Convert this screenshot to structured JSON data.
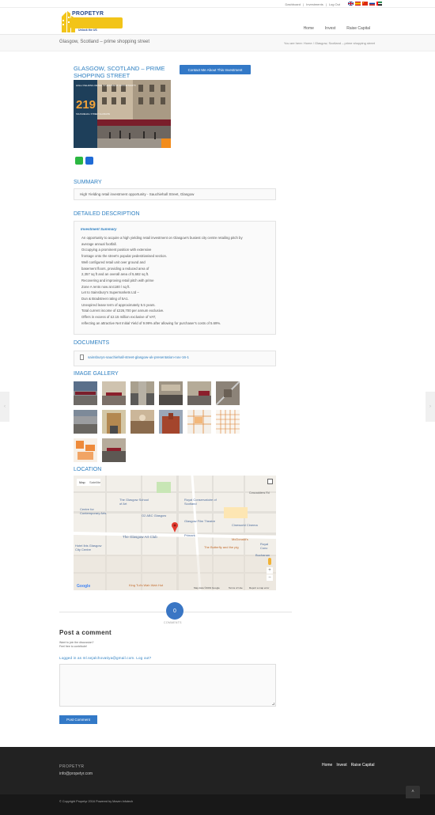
{
  "topbar": {
    "links": [
      "Dashboard",
      "Investments",
      "Log Out"
    ],
    "flags": [
      "uk-flag",
      "spain-flag",
      "china-flag",
      "russia-flag",
      "uae-flag"
    ]
  },
  "header": {
    "logo_text": "PROPETYR",
    "logo_tagline": "Unlock the US",
    "nav": [
      "Home",
      "Invest",
      "Raise Capital"
    ]
  },
  "breadcrumb_bar": {
    "page_title": "Glasgow, Scotland – prime shopping street",
    "you_are_here": "You are here:",
    "crumbs": [
      "Home",
      "Glasgow, Scotland – prime shopping street"
    ]
  },
  "property": {
    "title": "GLASGOW, SCOTLAND – PRIME SHOPPING STREET",
    "contact_button": "Contact Me About This Investment",
    "brochure": {
      "kicker": "HIGH-YIELDING RETAIL INVESTMENT OPPORTUNITY",
      "big_number": "219",
      "street": "SAUCHIEHALL STREET GLASGOW"
    }
  },
  "summary": {
    "heading": "SUMMARY",
    "text": "High Yielding retail investment opportunity - Sauchiehall Street, Glasgow"
  },
  "description": {
    "heading": "DETAILED DESCRIPTION",
    "subheading": "Investment Summary",
    "lines": [
      "An opportunity to acquire a high yielding retail investment on Glasgow's busiest city centre retailing pitch by",
      "average annual footfall.",
      "Occupying a prominent position with extensive",
      "frontage onto the street's popular pedestrianised section.",
      "Well configured retail unit over ground and",
      "basement floors, providing a reduced area of",
      "2,357 sq ft and an overall area of 5,682 sq ft.",
      "Recovering and improving retail pitch with prime",
      "Zone A rents now at £180 / sq ft.",
      "Let to Sainsbury's Supermarkets Ltd –",
      "Dun & Bradstreet rating of 5A1.",
      "Unexpired lease term of approximately 5.5 years.",
      "Total current income of £226,700 per annum exclusive.",
      "Offers in excess of £2.15 million exclusive of VAT,",
      "reflecting an attractive Net Initial Yield of 9.99% after allowing for purchaser's costs of 5.69%."
    ]
  },
  "documents": {
    "heading": "DOCUMENTS",
    "file": "sainsburys-sauchiehall-street-glasgow-uk-presentation-nov-16-1"
  },
  "gallery": {
    "heading": "IMAGE GALLERY",
    "count": 14
  },
  "location": {
    "heading": "LOCATION",
    "map_type": "Map",
    "sat_type": "Satellite",
    "labels": [
      "The Glasgow School of Art",
      "Royal Conservatoire of Scotland",
      "Centre for Contemporary Arts",
      "O2 ABC Glasgow",
      "Glasgow Film Theatre",
      "Cineworld Cinema",
      "The Glasgow Art Club",
      "Primark",
      "McDonald's",
      "The Butterfly and the pig",
      "Hotel Ibis Glasgow City Centre",
      "King Tut's Wah Wah Hut",
      "Buchanan",
      "Royal Conc",
      "Cowcaddens Rd"
    ],
    "attribution": "Map data ©2019 Google",
    "terms": "Terms of Use",
    "report": "Report a map error",
    "google": "Google"
  },
  "comments": {
    "count": "0",
    "label": "COMMENTS",
    "post_heading": "Post a comment",
    "want_line1": "Want to join the discussion?",
    "want_line2": "Feel free to contribute!",
    "logged_in": "Logged in as ml.sejalchovatiya@gmail.com. Log out?",
    "submit": "Post Comment"
  },
  "footer": {
    "brand": "PROPETYR",
    "email": "info@propetyr.com",
    "nav": [
      "Home",
      "Invest",
      "Raise Capital"
    ],
    "copyright": "© Copyright Propetyr 2016 Powered by Maven Infotech"
  },
  "colors": {
    "accent": "#2d7fc1",
    "button": "#3379c7",
    "footer_bg": "#222222",
    "logo_yellow": "#f2c419"
  }
}
